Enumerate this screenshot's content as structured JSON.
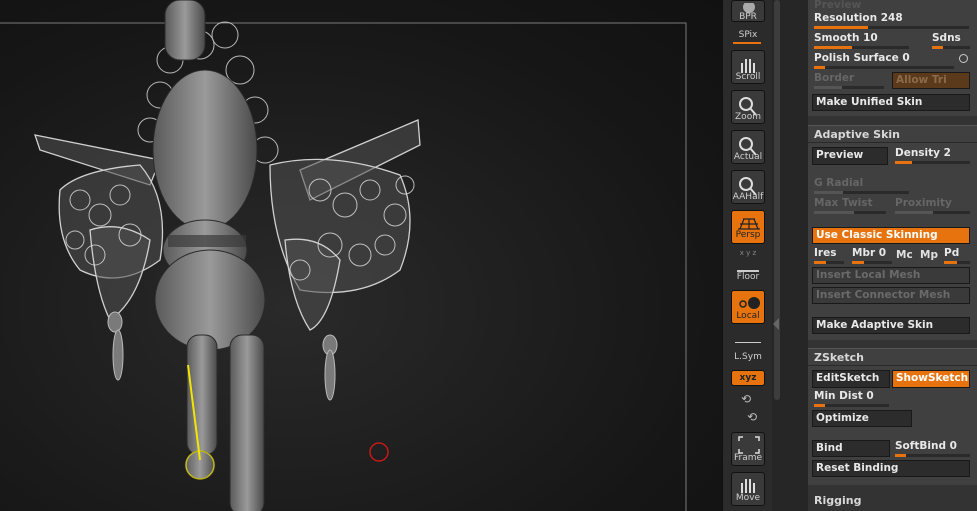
{
  "canvas": {
    "accent": "#e6730e"
  },
  "toolbar": {
    "bpr": "BPR",
    "spix": "SPix",
    "scroll": "Scroll",
    "zoom": "Zoom",
    "actual": "Actual",
    "aahalf": "AAHalf",
    "persp": "Persp",
    "floor": "Floor",
    "floor_axes": "x y z",
    "local": "Local",
    "lsym": "L.Sym",
    "xyz": "xyz",
    "frame": "Frame",
    "move": "Move"
  },
  "panel": {
    "preview_top": "Preview",
    "resolution": "Resolution 248",
    "smooth": "Smooth 10",
    "sdns": "Sdns",
    "polish": "Polish Surface 0",
    "border": "Border",
    "allow_tri": "Allow Tri",
    "make_unified": "Make Unified Skin",
    "adaptive": {
      "title": "Adaptive Skin",
      "preview": "Preview",
      "density": "Density 2",
      "g_radial": "G Radial",
      "max_twist": "Max Twist",
      "proximity": "Proximity",
      "use_classic": "Use Classic Skinning",
      "ires": "Ires",
      "mbr": "Mbr 0",
      "mc": "Mc",
      "mp": "Mp",
      "pd": "Pd",
      "insert_local": "Insert Local Mesh",
      "insert_connector": "Insert Connector Mesh",
      "make_adaptive": "Make Adaptive Skin"
    },
    "zsketch": {
      "title": "ZSketch",
      "edit": "EditSketch",
      "show": "ShowSketch",
      "min_dist": "Min Dist 0",
      "optimize": "Optimize",
      "bind": "Bind",
      "softbind": "SoftBind 0",
      "reset": "Reset Binding"
    },
    "rigging": "Rigging"
  }
}
